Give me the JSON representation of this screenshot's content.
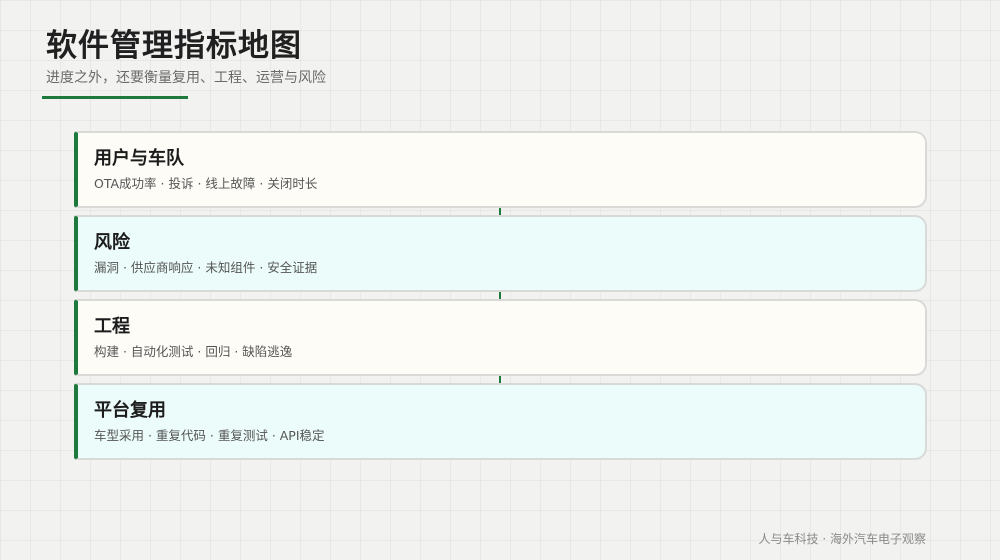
{
  "header": {
    "title": "软件管理指标地图",
    "subtitle": "进度之外，还要衡量复用、工程、运营与风险"
  },
  "layers": [
    {
      "title": "用户与车队",
      "desc": "OTA成功率 · 投诉 · 线上故障 · 关闭时长"
    },
    {
      "title": "风险",
      "desc": "漏洞 · 供应商响应 · 未知组件 · 安全证据"
    },
    {
      "title": "工程",
      "desc": "构建 · 自动化测试 · 回归 · 缺陷逃逸"
    },
    {
      "title": "平台复用",
      "desc": "车型采用 · 重复代码 · 重复测试 · API稳定"
    }
  ],
  "footer": {
    "source": "人与车科技 · 海外汽车电子观察"
  },
  "colors": {
    "accent": "#1e7a3c",
    "card_cream": "#fdfcf7",
    "card_mint": "#ecfcfa",
    "background": "#f2f2f0"
  }
}
